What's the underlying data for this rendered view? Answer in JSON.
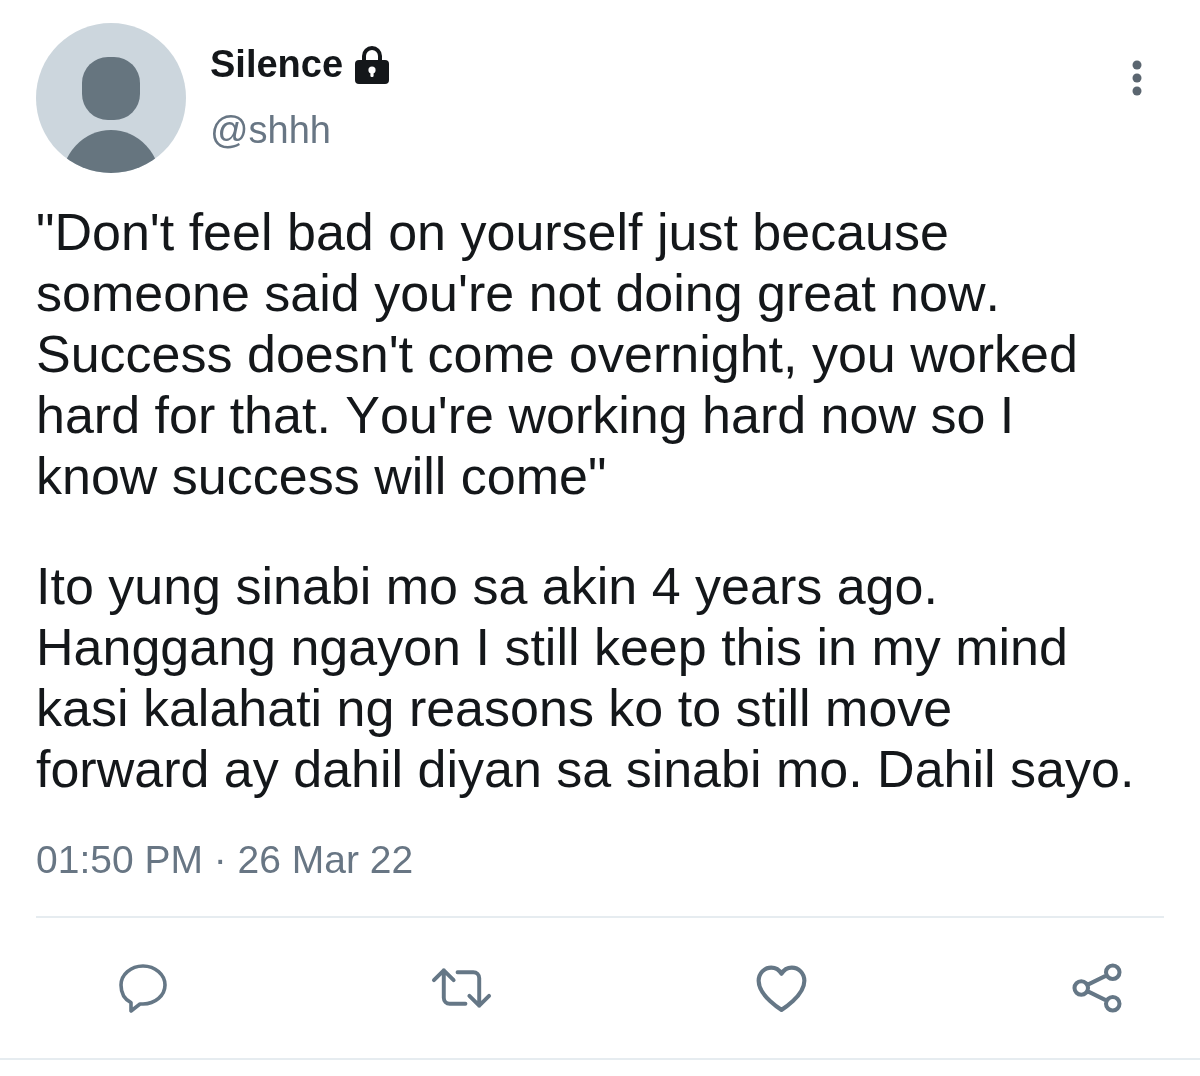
{
  "tweet": {
    "author": {
      "name": "Silence",
      "protected": true,
      "handle": "@shhh"
    },
    "paragraphs": [
      "\"Don't feel bad on yourself just because someone said you're not doing great now. Success doesn't come overnight, you worked hard for that. You're working hard now so I know success will come\"",
      "Ito yung sinabi mo sa akin 4 years ago. Hanggang ngayon I still keep this in my mind kasi kalahati ng reasons ko to still move forward ay dahil diyan sa sinabi mo. Dahil sayo."
    ],
    "timestamp": "01:50 PM · 26 Mar 22"
  }
}
